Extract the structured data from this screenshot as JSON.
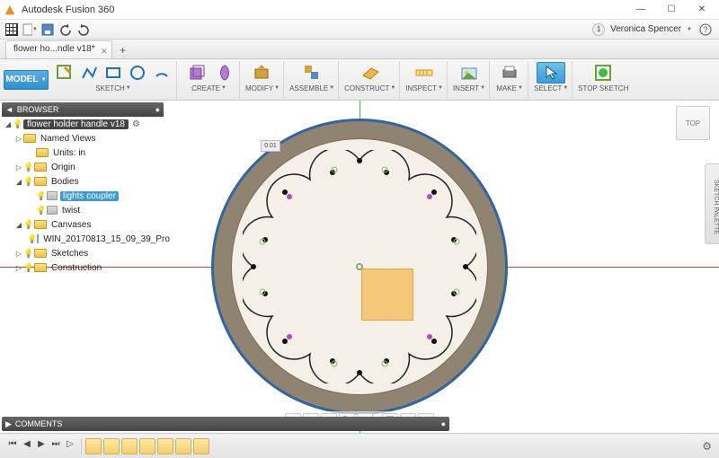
{
  "app": {
    "title": "Autodesk Fusion 360"
  },
  "user": {
    "name": "Veronica Spencer",
    "notif_count": "1"
  },
  "tab": {
    "label": "flower ho...ndle v18*"
  },
  "model_button": "MODEL",
  "ribbon": {
    "sketch": "SKETCH",
    "create": "CREATE",
    "modify": "MODIFY",
    "assemble": "ASSEMBLE",
    "construct": "CONSTRUCT",
    "inspect": "INSPECT",
    "insert": "INSERT",
    "make": "MAKE",
    "select": "SELECT",
    "stop": "STOP SKETCH"
  },
  "browser": {
    "header": "BROWSER",
    "root": "flower holder handle v18",
    "named_views": "Named Views",
    "units": "Units: in",
    "origin": "Origin",
    "bodies": "Bodies",
    "body1": "lights coupler",
    "body2": "twist",
    "canvases": "Canvases",
    "canvas1": "WIN_20170813_15_09_39_Pro",
    "sketches": "Sketches",
    "construction": "Construction"
  },
  "viewcube": "TOP",
  "palette": "SKETCH PALETTE",
  "dimension": "0.01",
  "comments": "COMMENTS"
}
